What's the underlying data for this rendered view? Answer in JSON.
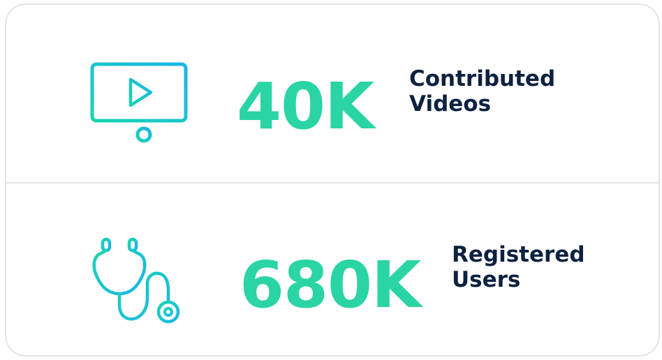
{
  "colors": {
    "accent": "#2ad4a4",
    "icon_gradient_start": "#17d6b0",
    "icon_gradient_end": "#1bb4e8",
    "label_text": "#0d2140",
    "border": "#e3e3e3"
  },
  "stats": [
    {
      "icon": "video-player-icon",
      "value": "40K",
      "label_line1": "Contributed",
      "label_line2": "Videos"
    },
    {
      "icon": "stethoscope-icon",
      "value": "680K",
      "label_line1": "Registered",
      "label_line2": "Users"
    }
  ]
}
